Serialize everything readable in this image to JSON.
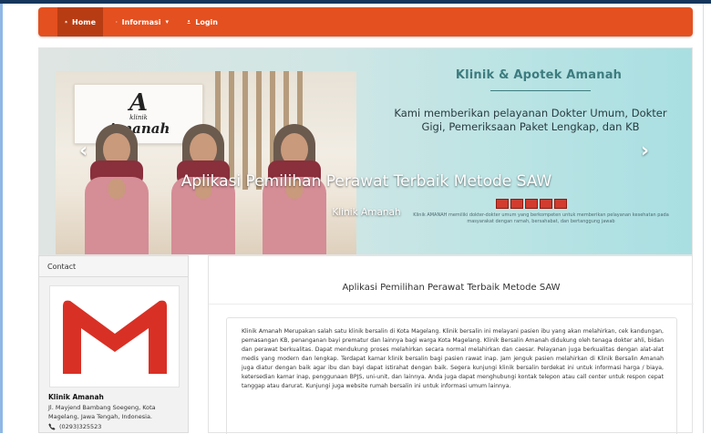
{
  "nav": {
    "items": [
      {
        "label": "Home",
        "icon": "home-icon"
      },
      {
        "label": "Informasi",
        "icon": "gear-icon",
        "caret": "▾"
      },
      {
        "label": "Login",
        "icon": "user-icon"
      }
    ]
  },
  "hero": {
    "title": "Klinik & Apotek Amanah",
    "description": "Kami memberikan pelayanan Dokter Umum, Dokter Gigi, Pemeriksaan Paket Lengkap, dan KB",
    "small_text": "Klinik AMANAH memiliki dokter-dokter umum yang berkompeten untuk memberikan pelayanan kesehatan pada masyarakat dengan ramah, bersahabat, dan bertanggung jawab",
    "caption_title": "Aplikasi Pemilihan Perawat Terbaik Metode SAW",
    "caption_sub": "Klinik Amanah",
    "photo_sign": {
      "big": "A",
      "small": "klinik",
      "name": "Amanah"
    },
    "prev": "‹",
    "next": "›"
  },
  "sidebar": {
    "heading": "Contact",
    "clinic_name": "Klinik Amanah",
    "address": "Jl. Mayjend Bambang Soegeng, Kota Magelang, Jawa Tengah, Indonesia.",
    "phone": "(0293)325523"
  },
  "main": {
    "title": "Aplikasi Pemilihan Perawat Terbaik Metode SAW",
    "paragraph": "Klinik Amanah Merupakan salah satu klinik bersalin di Kota Magelang. Klinik bersalin ini melayani pasien ibu yang akan melahirkan, cek kandungan, pemasangan KB, penanganan bayi prematur dan lainnya bagi warga Kota Magelang. Klinik Bersalin Amanah didukung oleh tenaga dokter ahli, bidan dan perawat berkualitas. Dapat mendukung proses melahirkan secara normal melahirkan dan caesar. Pelayanan juga berkualitas dengan alat-alat medis yang modern dan lengkap. Terdapat kamar klinik bersalin bagi pasien rawat inap. Jam jenguk pasien melahirkan di Klinik Bersalin Amanah juga diatur dengan baik agar ibu dan bayi dapat istirahat dengan baik. Segera kunjungi klinik bersalin terdekat ini untuk informasi harga / biaya, ketersedian kamar inap, penggunaan BPJS, uni-unit, dan lainnya. Anda juga dapat menghubungi kontak telepon atau call center untuk respon cepat tanggap atau darurat. Kunjungi juga website rumah bersalin ini untuk informasi umum lainnya."
  },
  "colors": {
    "navbar": "#e4501f",
    "navbar_active": "#b83c13",
    "hero_title": "#3d7c7f",
    "gmail_red": "#d93025"
  }
}
